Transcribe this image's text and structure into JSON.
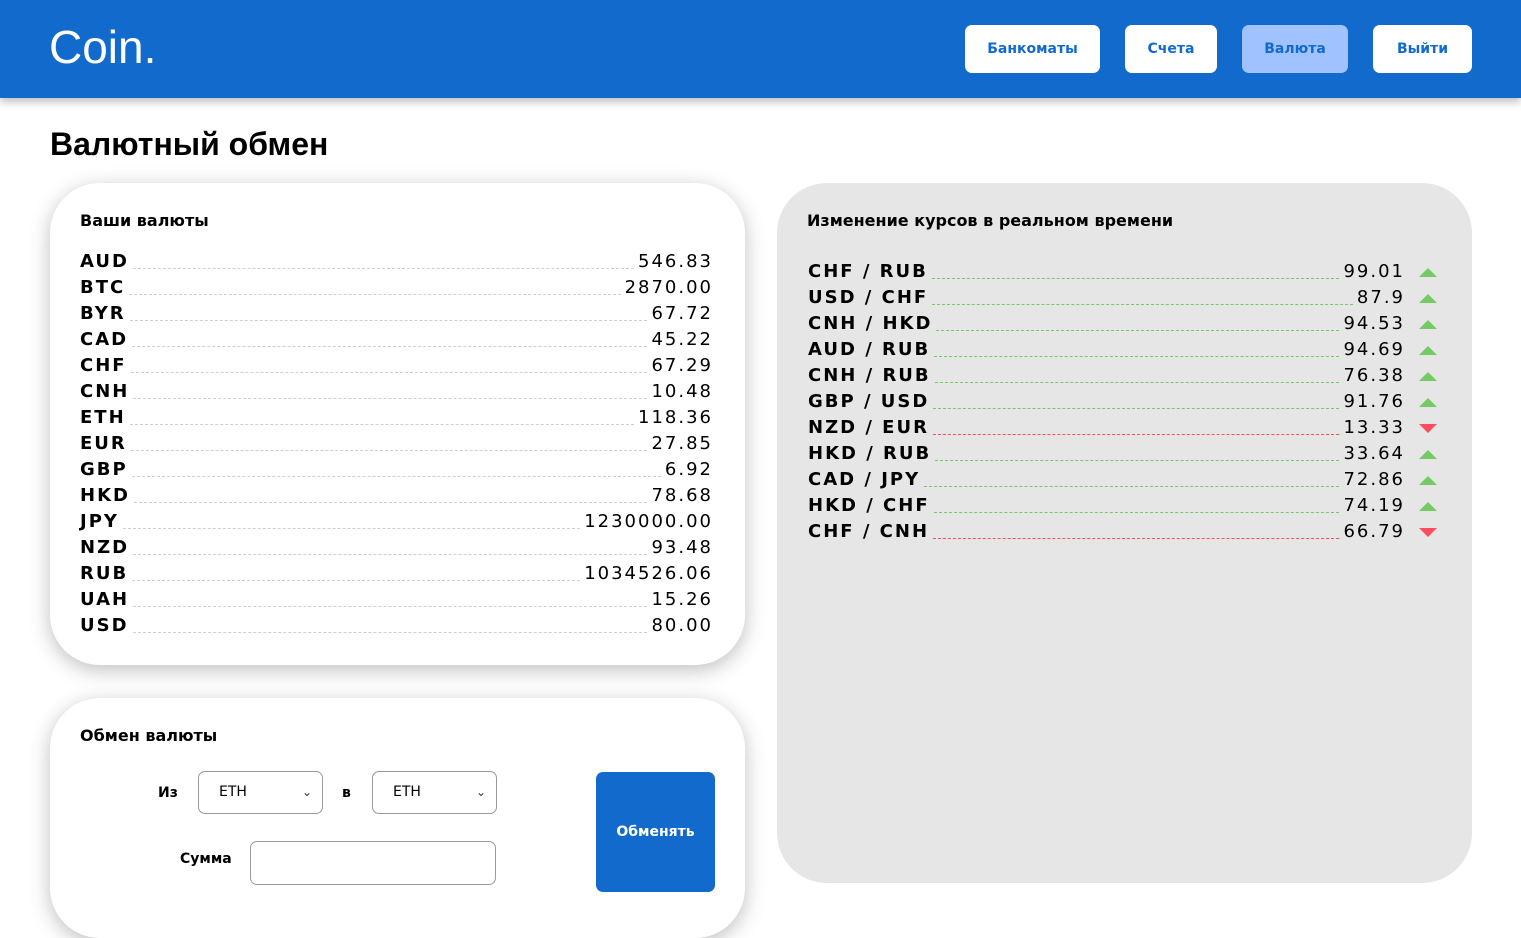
{
  "header": {
    "logo": "Coin.",
    "nav": [
      {
        "label": "Банкоматы",
        "active": false
      },
      {
        "label": "Счета",
        "active": false
      },
      {
        "label": "Валюта",
        "active": true
      },
      {
        "label": "Выйти",
        "active": false
      }
    ]
  },
  "page_title": "Валютный обмен",
  "your_currencies": {
    "title": "Ваши валюты",
    "items": [
      {
        "code": "AUD",
        "amount": "546.83"
      },
      {
        "code": "BTC",
        "amount": "2870.00"
      },
      {
        "code": "BYR",
        "amount": "67.72"
      },
      {
        "code": "CAD",
        "amount": "45.22"
      },
      {
        "code": "CHF",
        "amount": "67.29"
      },
      {
        "code": "CNH",
        "amount": "10.48"
      },
      {
        "code": "ETH",
        "amount": "118.36"
      },
      {
        "code": "EUR",
        "amount": "27.85"
      },
      {
        "code": "GBP",
        "amount": "6.92"
      },
      {
        "code": "HKD",
        "amount": "78.68"
      },
      {
        "code": "JPY",
        "amount": "1230000.00"
      },
      {
        "code": "NZD",
        "amount": "93.48"
      },
      {
        "code": "RUB",
        "amount": "1034526.06"
      },
      {
        "code": "UAH",
        "amount": "15.26"
      },
      {
        "code": "USD",
        "amount": "80.00"
      }
    ]
  },
  "exchange": {
    "title": "Обмен валюты",
    "from_label": "Из",
    "from_value": "ETH",
    "to_label": "в",
    "to_value": "ETH",
    "amount_label": "Сумма",
    "amount_value": "",
    "submit_label": "Обменять"
  },
  "rates": {
    "title": "Изменение курсов в реальном времени",
    "up_color": "#76ca66",
    "down_color": "#fd4e5d",
    "items": [
      {
        "pair": "CHF / RUB",
        "rate": "99.01",
        "direction": "up"
      },
      {
        "pair": "USD / CHF",
        "rate": "87.9",
        "direction": "up"
      },
      {
        "pair": "CNH / HKD",
        "rate": "94.53",
        "direction": "up"
      },
      {
        "pair": "AUD / RUB",
        "rate": "94.69",
        "direction": "up"
      },
      {
        "pair": "CNH / RUB",
        "rate": "76.38",
        "direction": "up"
      },
      {
        "pair": "GBP / USD",
        "rate": "91.76",
        "direction": "up"
      },
      {
        "pair": "NZD / EUR",
        "rate": "13.33",
        "direction": "down"
      },
      {
        "pair": "HKD / RUB",
        "rate": "33.64",
        "direction": "up"
      },
      {
        "pair": "CAD / JPY",
        "rate": "72.86",
        "direction": "up"
      },
      {
        "pair": "HKD / CHF",
        "rate": "74.19",
        "direction": "up"
      },
      {
        "pair": "CHF / CNH",
        "rate": "66.79",
        "direction": "down"
      }
    ]
  },
  "colors": {
    "brand": "#116acc",
    "active_nav": "#a0c3ff",
    "rates_bg": "#e6e6e6"
  }
}
